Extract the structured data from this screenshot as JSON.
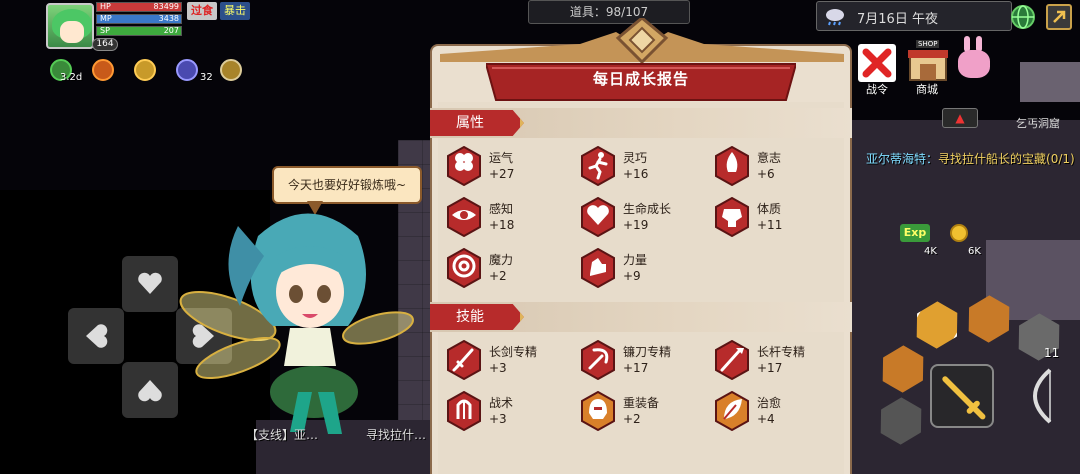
{
  "hud": {
    "level": "164",
    "hp_label": "HP",
    "hp_value": "83499",
    "mp_label": "MP",
    "mp_value": "3438",
    "sp_label": "SP",
    "sp_value": "207",
    "tag_overeat": "过食",
    "tag_hungry": "暴击",
    "buff_time": "3.2d",
    "buff_count": "32",
    "items_label": "道具：98/107",
    "date": "7月16日 午夜",
    "war_order": "战令",
    "shop": "商城",
    "shop_sign": "SHOP",
    "cave": "乞丐洞窟",
    "quest_right_prefix": "亚尔蒂海特：",
    "quest_right_text": "寻找拉什船长的宝藏(0/1)",
    "exp_tag": "Exp",
    "pickup_a": "4K",
    "pickup_b": "6K",
    "skill_count": "11",
    "bottom_quest": "【支线】亚…　　　　寻找拉什…"
  },
  "fairy": {
    "speech": "今天也要好好锻炼哦~"
  },
  "report": {
    "title": "每日成长报告",
    "attributes_header": "属性",
    "skills_header": "技能",
    "attributes": [
      {
        "name": "运气",
        "value": "+27",
        "icon": "clover-icon"
      },
      {
        "name": "灵巧",
        "value": "+16",
        "icon": "running-man-icon"
      },
      {
        "name": "意志",
        "value": "+6",
        "icon": "will-flame-icon"
      },
      {
        "name": "感知",
        "value": "+18",
        "icon": "eye-icon"
      },
      {
        "name": "生命成长",
        "value": "+19",
        "icon": "heart-icon"
      },
      {
        "name": "体质",
        "value": "+11",
        "icon": "muscle-body-icon"
      },
      {
        "name": "魔力",
        "value": "+2",
        "icon": "magic-swirl-icon"
      },
      {
        "name": "力量",
        "value": "+9",
        "icon": "arm-flex-icon"
      }
    ],
    "skills": [
      {
        "name": "长剑专精",
        "value": "+3",
        "icon": "sword-icon"
      },
      {
        "name": "镰刀专精",
        "value": "+17",
        "icon": "sickle-icon"
      },
      {
        "name": "长杆专精",
        "value": "+17",
        "icon": "polearm-icon"
      },
      {
        "name": "战术",
        "value": "+3",
        "icon": "tactics-icon"
      },
      {
        "name": "重装备",
        "value": "+2",
        "icon": "helmet-icon"
      },
      {
        "name": "治愈",
        "value": "+4",
        "icon": "leaf-icon"
      }
    ]
  },
  "colors": {
    "accent_red": "#b72b2b",
    "panel_bg": "#eadfcf",
    "gold": "#e0b45a"
  }
}
